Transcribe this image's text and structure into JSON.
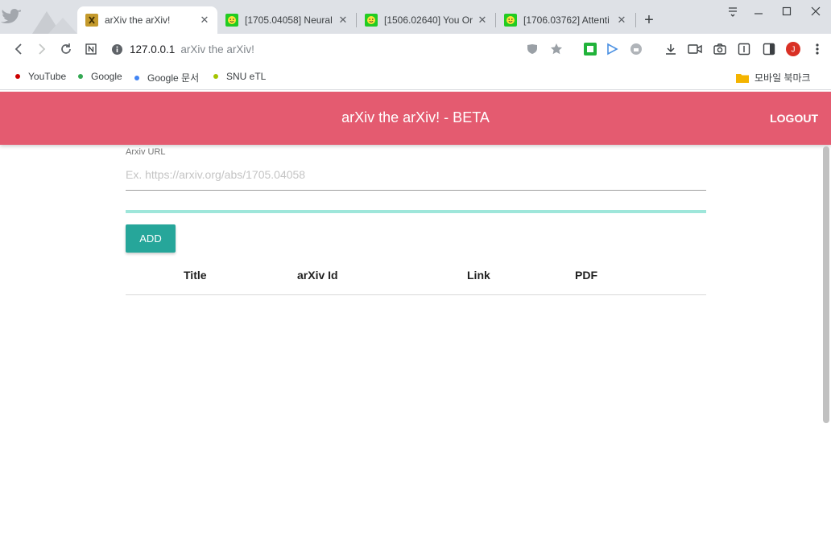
{
  "browser": {
    "tabs": [
      {
        "title": "arXiv the arXiv!",
        "active": true
      },
      {
        "title": "[1705.04058] Neural",
        "active": false
      },
      {
        "title": "[1506.02640] You Or",
        "active": false
      },
      {
        "title": "[1706.03762] Attenti",
        "active": false
      }
    ],
    "new_tab_label": "+",
    "url_host": "127.0.0.1",
    "url_page_title": "arXiv the arXiv!",
    "bookmarks": [
      {
        "label": "YouTube",
        "color": "#cc0000"
      },
      {
        "label": "Google",
        "color": "#34a853"
      },
      {
        "label": "Google 문서",
        "color": "#4285f4"
      },
      {
        "label": "SNU eTL",
        "color": "#a4c400"
      }
    ],
    "bookmarks_folder": "모바일 북마크",
    "profile_initial": "J"
  },
  "app": {
    "title": "arXiv the arXiv! - BETA",
    "logout_label": "LOGOUT",
    "header_color": "#e45b70",
    "form": {
      "label": "Arxiv URL",
      "placeholder": "Ex. https://arxiv.org/abs/1705.04058",
      "value": "",
      "add_label": "ADD",
      "button_color": "#26a69a"
    },
    "table": {
      "columns": [
        "Title",
        "arXiv Id",
        "Link",
        "PDF"
      ],
      "rows": []
    }
  }
}
